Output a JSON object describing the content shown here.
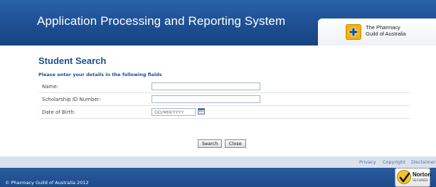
{
  "header": {
    "app_title": "Application Processing and Reporting System",
    "logo": {
      "line1": "The Pharmacy",
      "line2": "Guild of Australia",
      "icon": "pharmacy-cross-icon"
    }
  },
  "main": {
    "title": "Student Search",
    "instructions": "Please enter your details in the following fields",
    "fields": [
      {
        "label": "Name:",
        "value": "",
        "placeholder": ""
      },
      {
        "label": "Scholarship ID Number:",
        "value": "",
        "placeholder": ""
      },
      {
        "label": "Date of Birth:",
        "value": "",
        "placeholder": "DD/MM/YYYY",
        "icon": "calendar-icon"
      }
    ],
    "buttons": {
      "search": "Search",
      "close": "Close"
    }
  },
  "links": [
    "Privacy",
    "Copyright",
    "Disclaimer"
  ],
  "footer": {
    "copyright": "© Pharmacy Guild of Australia 2012",
    "badge": {
      "brand": "Norton",
      "subtitle": "SECURED",
      "icon": "checkmark-icon"
    }
  },
  "colors": {
    "header_blue": "#1d4f93",
    "title_blue": "#1e4f8e",
    "link_blue": "#4f72a8",
    "links_bar": "#d9e1ec",
    "logo_yellow": "#f4b400"
  }
}
